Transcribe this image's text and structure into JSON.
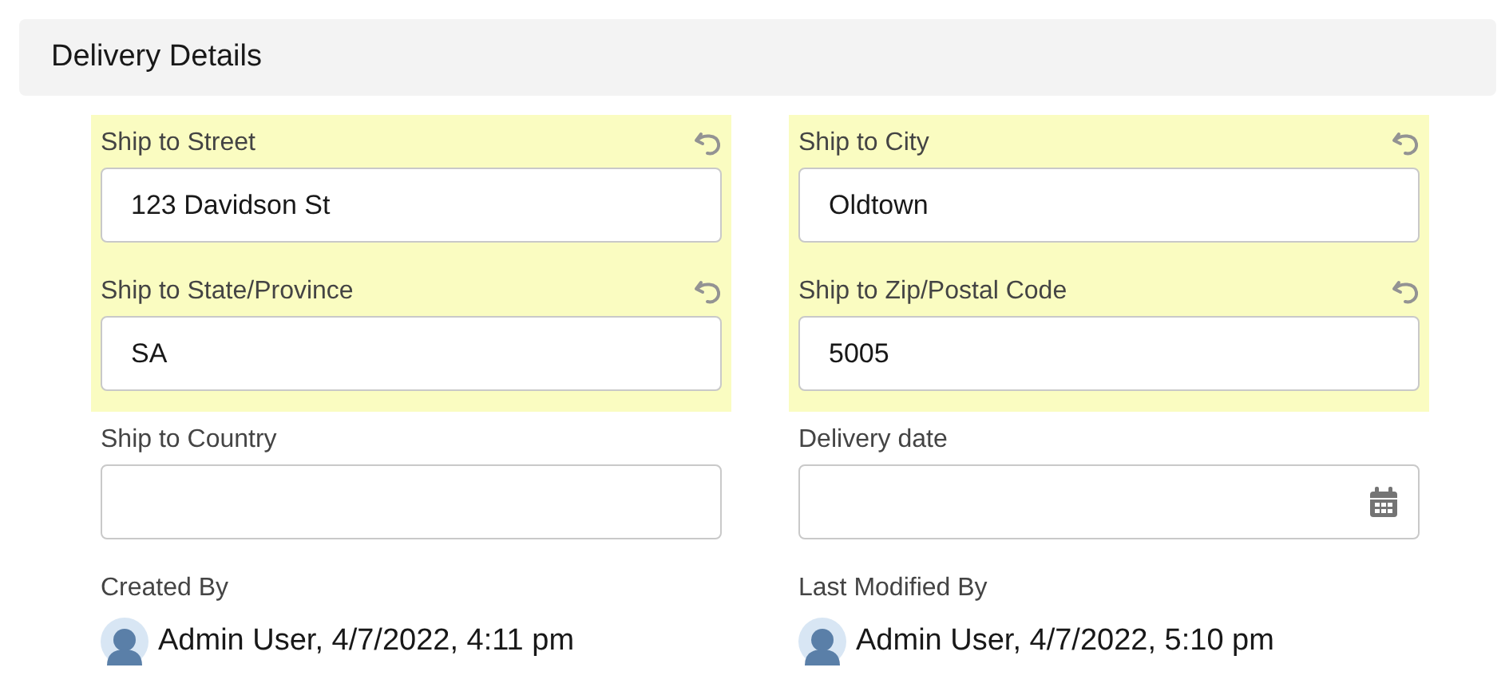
{
  "section": {
    "title": "Delivery Details"
  },
  "fields": [
    {
      "label": "Ship to Street",
      "value": "123 Davidson St",
      "kind": "text",
      "changed": true
    },
    {
      "label": "Ship to City",
      "value": "Oldtown",
      "kind": "text",
      "changed": true
    },
    {
      "label": "Ship to State/Province",
      "value": "SA",
      "kind": "text",
      "changed": true
    },
    {
      "label": "Ship to Zip/Postal Code",
      "value": "5005",
      "kind": "text",
      "changed": true
    },
    {
      "label": "Ship to Country",
      "kind": "text",
      "changed": false
    },
    {
      "label": "Delivery date",
      "kind": "date",
      "changed": false
    }
  ],
  "audit": [
    {
      "label": "Created By",
      "text": "Admin User, 4/7/2022, 4:11 pm"
    },
    {
      "label": "Last Modified By",
      "text": "Admin User, 4/7/2022, 5:10 pm"
    }
  ]
}
